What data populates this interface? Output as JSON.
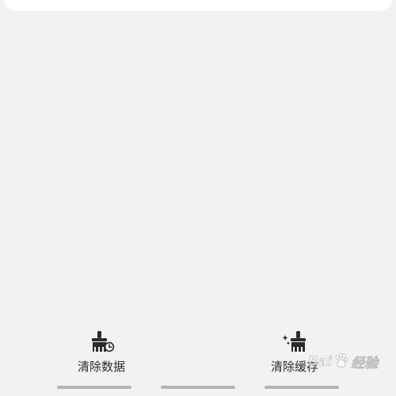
{
  "actions": {
    "clear_data": {
      "label": "清除数据",
      "icon": "broom-clock-icon"
    },
    "clear_cache": {
      "label": "清除缓存",
      "icon": "broom-sparkle-icon"
    }
  },
  "watermark": {
    "brand_prefix": "Bai",
    "brand_suffix": "经验",
    "icon": "baidu-paw-icon"
  },
  "colors": {
    "background": "#f2f2f2",
    "card": "#ffffff",
    "icon": "#2b2b2b",
    "bar": "#b3b3b3"
  }
}
